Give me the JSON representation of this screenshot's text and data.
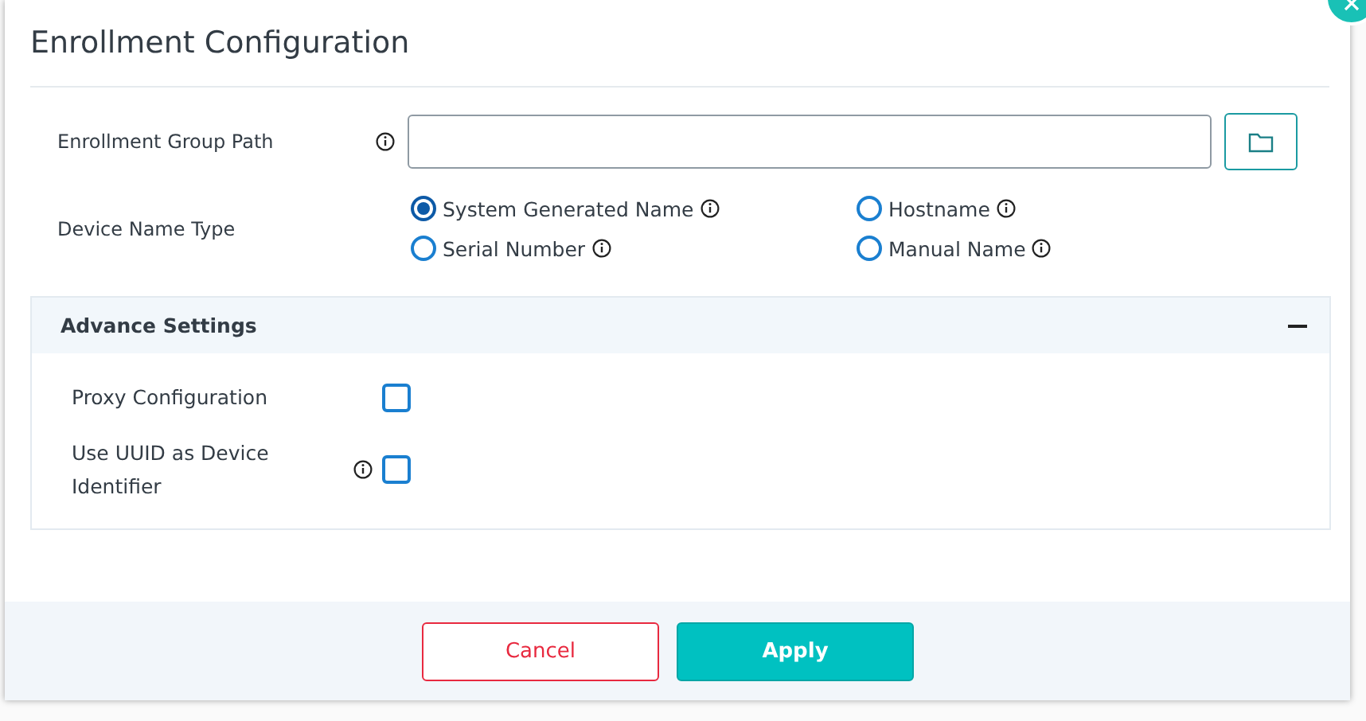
{
  "dialog": {
    "title": "Enrollment Configuration"
  },
  "group_path": {
    "label": "Enrollment Group Path"
  },
  "device_name_type": {
    "label": "Device Name Type",
    "options": [
      {
        "label": "System Generated Name",
        "selected": true,
        "info": true
      },
      {
        "label": "Hostname",
        "selected": false,
        "info": true
      },
      {
        "label": "Serial Number",
        "selected": false,
        "info": true
      },
      {
        "label": "Manual Name",
        "selected": false,
        "info": true
      }
    ]
  },
  "advance_settings": {
    "title": "Advance Settings",
    "expanded": true,
    "items": [
      {
        "label": "Proxy Configuration",
        "checked": false,
        "info": false
      },
      {
        "label": "Use UUID as Device Identifier",
        "checked": false,
        "info": true
      }
    ]
  },
  "buttons": [
    {
      "label": "Cancel",
      "kind": "secondary"
    },
    {
      "label": "Apply",
      "kind": "primary"
    }
  ]
}
